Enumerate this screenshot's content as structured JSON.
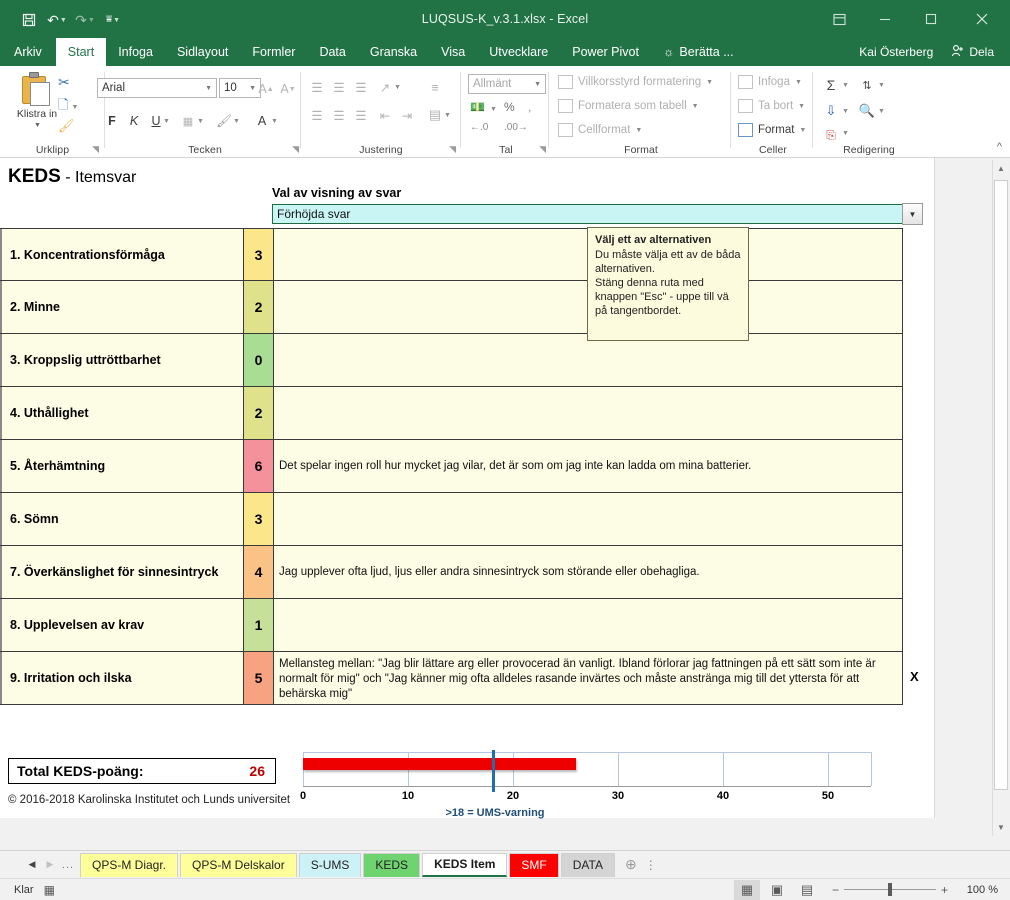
{
  "window": {
    "title": "LUQSUS-K_v.3.1.xlsx - Excel",
    "qat": [
      {
        "name": "save",
        "glyph": "Ὃe"
      },
      {
        "name": "undo",
        "glyph": "↶"
      },
      {
        "name": "redo",
        "glyph": "↷"
      },
      {
        "name": "customize",
        "glyph": "☴"
      }
    ],
    "controls": {
      "ribbon_display": "Ribbon Display Options",
      "minimize": "–",
      "maximize": "□",
      "close": "✕"
    }
  },
  "ribbon": {
    "tabs": [
      {
        "label": "Arkiv",
        "active": false
      },
      {
        "label": "Start",
        "active": true
      },
      {
        "label": "Infoga",
        "active": false
      },
      {
        "label": "Sidlayout",
        "active": false
      },
      {
        "label": "Formler",
        "active": false
      },
      {
        "label": "Data",
        "active": false
      },
      {
        "label": "Granska",
        "active": false
      },
      {
        "label": "Visa",
        "active": false
      },
      {
        "label": "Utvecklare",
        "active": false
      },
      {
        "label": "Power Pivot",
        "active": false
      },
      {
        "label": "Berätta ...",
        "active": false
      }
    ],
    "user_name": "Kai Österberg",
    "share_label": "Dela",
    "groups": {
      "clipboard": {
        "label": "Urklipp",
        "paste_label": "Klistra in",
        "cut_label": "Klipp ut",
        "copy_label": "Kopiera",
        "format_painter_label": "Hämta format"
      },
      "font": {
        "label": "Tecken",
        "font_name": "Arial",
        "font_size": "10",
        "bold": "F",
        "italic": "K",
        "underline": "U"
      },
      "alignment": {
        "label": "Justering"
      },
      "number": {
        "label": "Tal",
        "format_value": "Allmänt",
        "percent": "%",
        "thousands": ","
      },
      "styles": {
        "label": "Format",
        "items": [
          "Villkorsstyrd formatering",
          "Formatera som tabell",
          "Cellformat"
        ]
      },
      "cells": {
        "label": "Celler",
        "items": [
          "Infoga",
          "Ta bort",
          "Format"
        ]
      },
      "editing": {
        "label": "Redigering",
        "items": [
          "AutoSumma",
          "Fyll",
          "Sortera och filtrera",
          "Sök och markera",
          "Radera"
        ]
      }
    }
  },
  "sheet": {
    "title_bold": "KEDS",
    "title_rest": " - Itemsvar",
    "selector_label": "Val av visning av svar",
    "selector_value": "Förhöjda svar",
    "selector_arrow": "▼",
    "items": [
      {
        "name": "1. Koncentrationsförmåga",
        "score": "3",
        "color": "#fbe68a",
        "answer": ""
      },
      {
        "name": "2. Minne",
        "score": "2",
        "color": "#dfe28a",
        "answer": ""
      },
      {
        "name": "3. Kroppslig uttröttbarhet",
        "score": "0",
        "color": "#a9dd93",
        "answer": ""
      },
      {
        "name": "4. Uthållighet",
        "score": "2",
        "color": "#dfe28a",
        "answer": ""
      },
      {
        "name": "5. Återhämtning",
        "score": "6",
        "color": "#f4919b",
        "answer": "Det spelar ingen roll hur mycket jag vilar, det är som om jag inte kan ladda om mina batterier."
      },
      {
        "name": "6. Sömn",
        "score": "3",
        "color": "#fbe68a",
        "answer": ""
      },
      {
        "name": "7. Överkänslighet för sinnesintryck",
        "score": "4",
        "color": "#fac284",
        "answer": "Jag upplever ofta ljud, ljus eller andra sinnesintryck som störande eller obehagliga."
      },
      {
        "name": "8. Upplevelsen av krav",
        "score": "1",
        "color": "#c6e09a",
        "answer": ""
      },
      {
        "name": "9. Irritation och ilska",
        "score": "5",
        "color": "#f7a281",
        "answer": "Mellansteg mellan: \"Jag blir lättare arg eller provocerad än vanligt. Ibland förlorar jag fattningen på ett sätt som inte är normalt för mig\" och \"Jag känner mig ofta alldeles rasande invärtes och måste anstränga mig till det yttersta för att behärska mig\"",
        "marker": "X"
      }
    ],
    "total_label": "Total KEDS-poäng:",
    "total_value": "26",
    "copyright": "© 2016-2018 Karolinska Institutet och Lunds universitet",
    "tooltip": {
      "title": "Välj ett av alternativen",
      "line1": "Du måste välja ett av de båda alternativen.",
      "line2": "Stäng denna ruta med knappen \"Esc\" - uppe till vä på tangentbordet."
    }
  },
  "chart_data": {
    "type": "bar",
    "orientation": "horizontal",
    "categories": [
      "Total KEDS-poäng"
    ],
    "values": [
      26
    ],
    "title": "",
    "xlabel": "",
    "ylabel": "",
    "xlim": [
      0,
      54
    ],
    "ticks": [
      0,
      10,
      20,
      30,
      40,
      50
    ],
    "tick_labels": [
      "0",
      "10",
      "20",
      "30",
      "40",
      "50"
    ],
    "grid": true,
    "legend": "none",
    "bar_color": "#ee0000",
    "marker": {
      "value": 18,
      "color": "#1f6fa8",
      "label": ">18 = UMS-varning"
    }
  },
  "sheet_tabs": {
    "nav": {
      "prev": "◀",
      "next": "▶",
      "more": "..."
    },
    "tabs": [
      {
        "label": "QPS-M Diagr.",
        "color": "#ffff99",
        "active": false
      },
      {
        "label": "QPS-M Delskalor",
        "color": "#ffff99",
        "active": false
      },
      {
        "label": "S-UMS",
        "color": "#ccf2f7",
        "active": false
      },
      {
        "label": "KEDS",
        "color": "#6fd36f",
        "active": false
      },
      {
        "label": "KEDS Item",
        "color": "#ffffff",
        "active": true
      },
      {
        "label": "SMF",
        "color": "#ff0000",
        "active": false
      },
      {
        "label": "DATA",
        "color": "#d4d4d4",
        "active": false
      }
    ],
    "add_label": "+"
  },
  "status": {
    "mode": "Klar",
    "views": [
      "Normal",
      "Sidlayout",
      "Förhandsgranska sidbrytningar"
    ],
    "zoom_out": "−",
    "zoom_in": "+",
    "zoom_level": "100 %"
  }
}
